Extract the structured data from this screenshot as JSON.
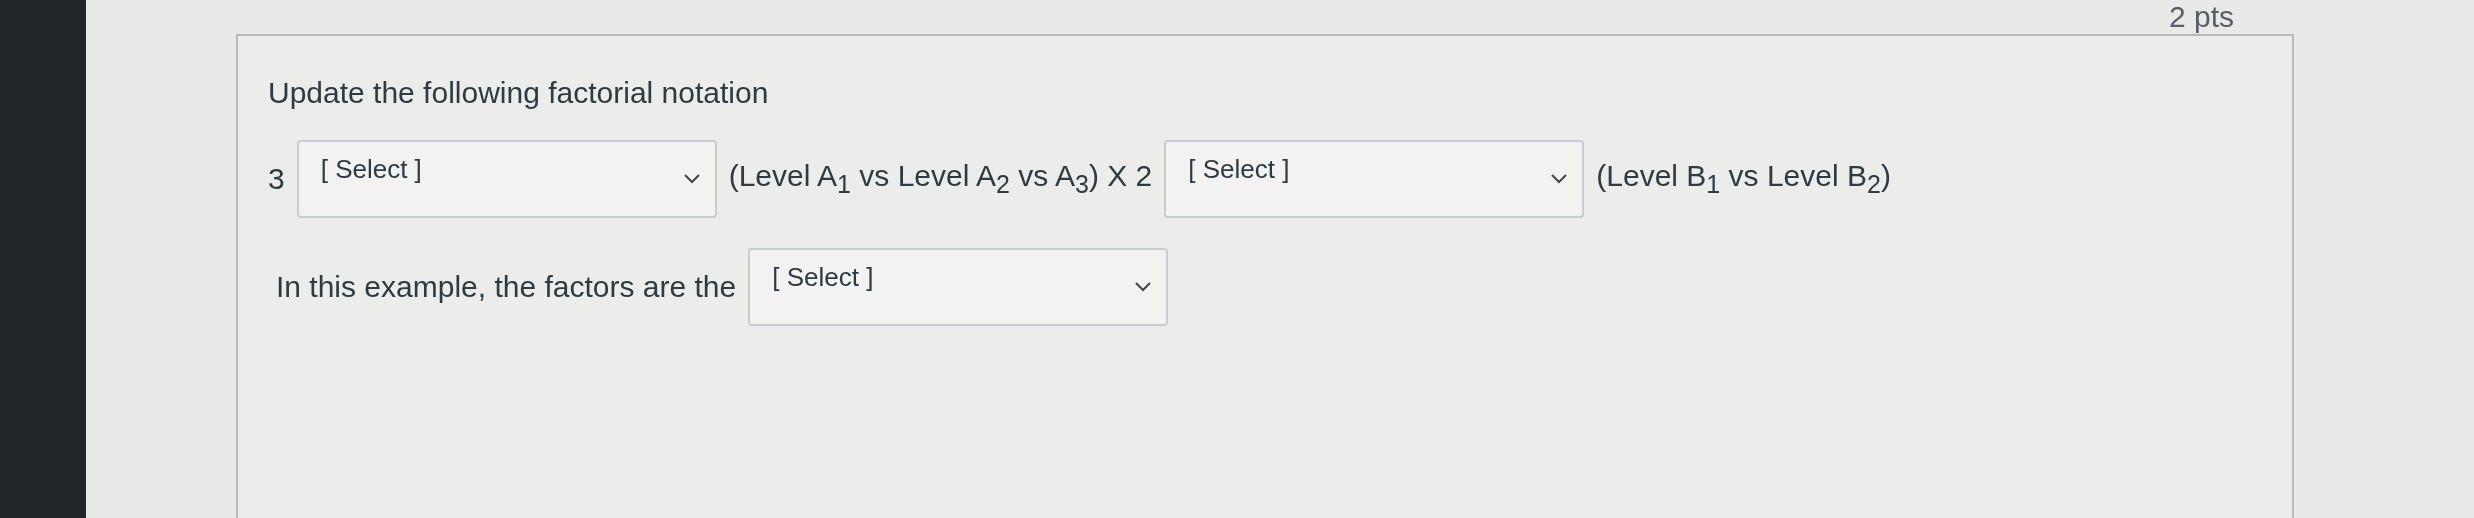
{
  "points": "2 pts",
  "prompt": "Update the following factorial notation",
  "line1": [
    {
      "kind": "text",
      "text": "3"
    },
    {
      "kind": "select",
      "value": "[ Select ]"
    },
    {
      "kind": "text",
      "text": "(Level A$_{1}$ vs Level A$_{2}$ vs A$_{3}$) X 2"
    },
    {
      "kind": "select",
      "value": "[ Select ]"
    },
    {
      "kind": "text",
      "text": "(Level B$_{1}$ vs Level B$_{2}$)"
    }
  ],
  "line2": [
    {
      "kind": "text",
      "text": "In this example, the factors are the"
    },
    {
      "kind": "select",
      "value": "[ Select ]"
    }
  ]
}
